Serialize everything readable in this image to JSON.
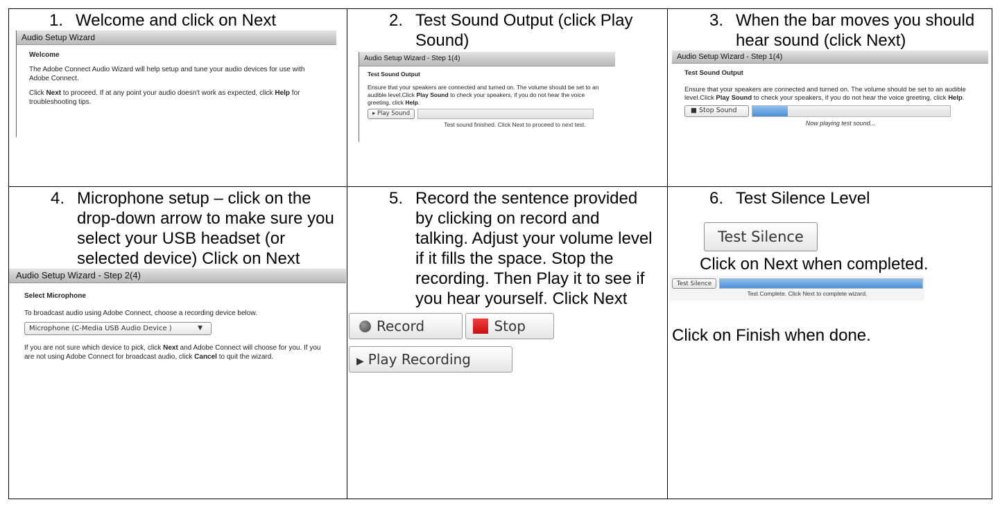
{
  "steps": [
    {
      "num": "1.",
      "text": "Welcome and click on Next"
    },
    {
      "num": "2.",
      "text": "Test Sound Output (click Play Sound)"
    },
    {
      "num": "3.",
      "text": "When the bar moves you should hear sound (click Next)"
    },
    {
      "num": "4.",
      "text": "Microphone setup – click on the drop-down arrow to make sure you select your USB headset (or selected device) Click on Next"
    },
    {
      "num": "5.",
      "text": "Record the sentence provided by clicking on record and talking. Adjust your volume level if it fills the space. Stop the recording. Then Play it to see if you hear yourself. Click Next"
    },
    {
      "num": "6.",
      "text": "Test Silence Level"
    }
  ],
  "shot1": {
    "title": "Audio Setup Wizard",
    "heading": "Welcome",
    "para1": "The Adobe Connect Audio Wizard will help setup and tune your audio devices for use with Adobe Connect.",
    "para2_a": "Click ",
    "para2_b": "Next",
    "para2_c": " to proceed. If at any point your audio doesn't work as expected, click ",
    "para2_d": "Help",
    "para2_e": " for troubleshooting tips."
  },
  "shot2": {
    "title": "Audio Setup Wizard - Step 1(4)",
    "heading": "Test Sound Output",
    "para_a": "Ensure that your speakers are connected and turned on. The volume should be set to an audible level.Click ",
    "para_b": "Play Sound",
    "para_c": " to check your speakers, if you do not hear the voice greeting, click ",
    "para_d": "Help",
    "para_e": ".",
    "button": "▸ Play Sound",
    "status": "Test sound finished. Click Next to proceed to next test.",
    "progress": 0
  },
  "shot3": {
    "title": "Audio Setup Wizard - Step 1(4)",
    "heading": "Test Sound Output",
    "para_a": "Ensure that your speakers are connected and turned on. The volume should be set to an audible level.Click ",
    "para_b": "Play Sound",
    "para_c": " to check your speakers, if you do not hear the voice greeting, click ",
    "para_d": "Help",
    "para_e": ".",
    "button": "■ Stop Sound",
    "status": "Now playing test sound...",
    "progress": 0.18
  },
  "shot4": {
    "title": "Audio Setup Wizard - Step 2(4)",
    "heading": "Select Microphone",
    "para1": "To broadcast audio using Adobe Connect, choose a recording device below.",
    "select_value": "Microphone (C-Media USB Audio Device  )",
    "para2_a": "If you are not sure which device to pick, click ",
    "para2_b": "Next",
    "para2_c": " and Adobe Connect will choose for you. If you are not using Adobe Connect for broadcast audio, click ",
    "para2_d": "Cancel",
    "para2_e": " to quit the wizard."
  },
  "cell5": {
    "record_label": "Record",
    "stop_label": "Stop",
    "play_label": "Play Recording"
  },
  "cell6": {
    "test_silence_big": "Test Silence",
    "click_next": "Click on Next when completed.",
    "test_silence_small": "Test Silence",
    "status": "Test Complete. Click Next to complete wizard.",
    "progress": 1.0,
    "finish_text": "Click on Finish when done."
  },
  "colors": {
    "progress_fill": "#4b8fd6",
    "stop_red": "#e02020",
    "record_gray": "#666666"
  }
}
